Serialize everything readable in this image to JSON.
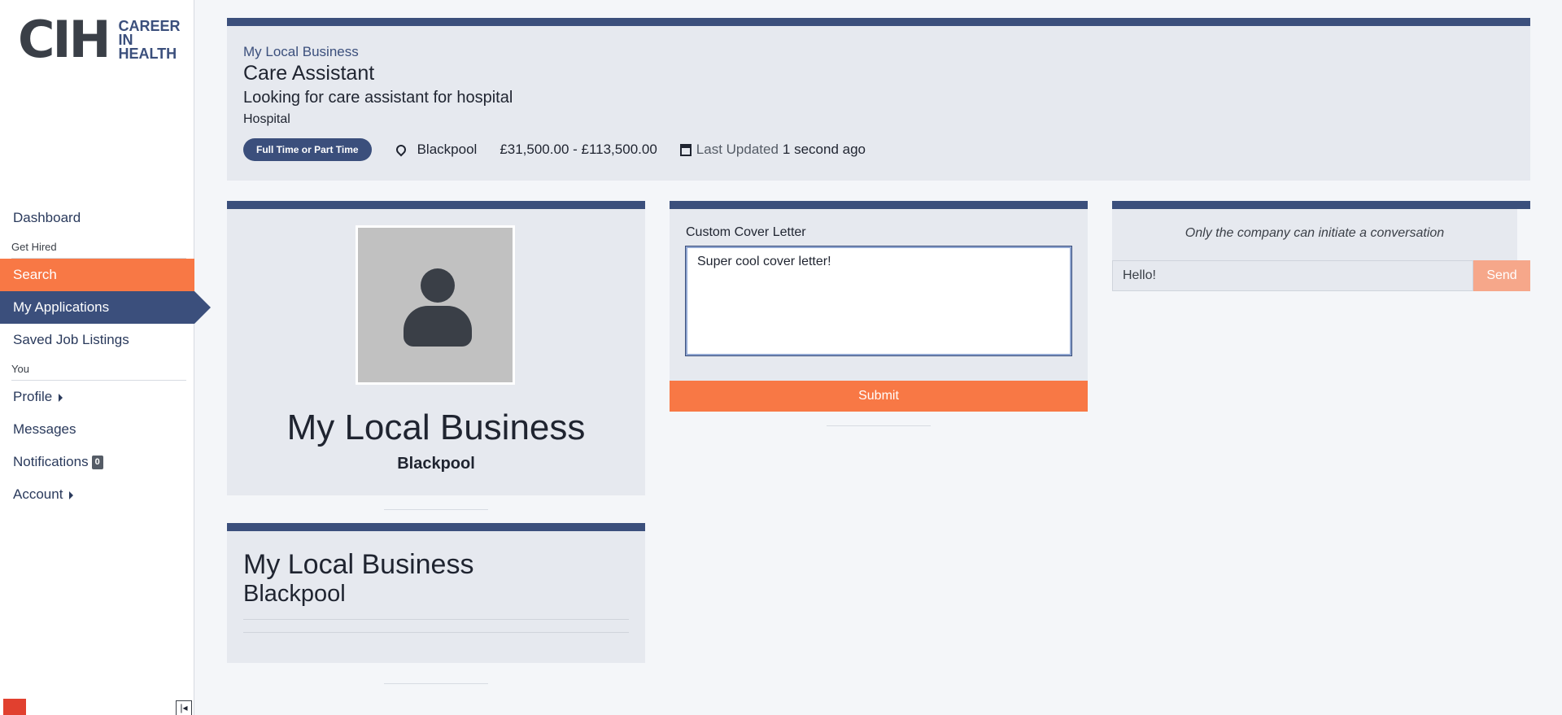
{
  "sidebar": {
    "logo_mark": "CIH",
    "logo_line1": "CAREER",
    "logo_line2": "IN",
    "logo_line3": "HEALTH",
    "dashboard": "Dashboard",
    "section_get_hired": "Get Hired",
    "search": "Search",
    "my_applications": "My Applications",
    "saved_job_listings": "Saved Job Listings",
    "section_you": "You",
    "profile": "Profile",
    "messages": "Messages",
    "notifications": "Notifications",
    "notifications_count": "0",
    "account": "Account"
  },
  "job": {
    "company": "My Local Business",
    "title": "Care Assistant",
    "subtitle": "Looking for care assistant for hospital",
    "category": "Hospital",
    "employment_type": "Full Time or Part Time",
    "location": "Blackpool",
    "salary": "£31,500.00 - £113,500.00",
    "last_updated_label": "Last Updated",
    "last_updated_value": "1 second ago"
  },
  "company_card": {
    "name": "My Local Business",
    "location": "Blackpool"
  },
  "company_info": {
    "name": "My Local Business",
    "location": "Blackpool"
  },
  "cover_letter": {
    "label": "Custom Cover Letter",
    "value": "Super cool cover letter!",
    "submit_label": "Submit"
  },
  "conversation": {
    "note": "Only the company can initiate a conversation",
    "input_value": "Hello!",
    "send_label": "Send"
  },
  "colors": {
    "primary": "#3b4f7c",
    "accent": "#f87845",
    "accent_disabled": "#f6a78a",
    "card_bg": "#e6e9ef"
  }
}
